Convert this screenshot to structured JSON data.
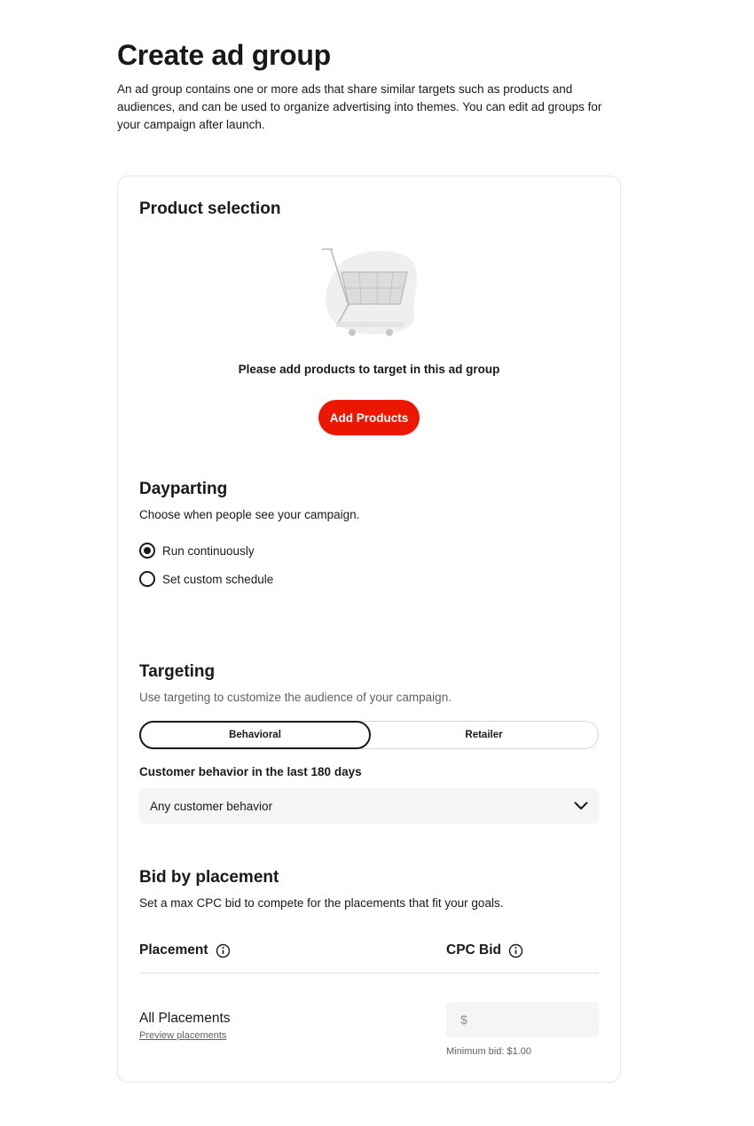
{
  "page": {
    "title": "Create ad group",
    "description": "An ad group contains one or more ads that share similar targets such as products and audiences, and can be used to organize advertising into themes. You can edit ad groups for your campaign after launch."
  },
  "product_selection": {
    "title": "Product selection",
    "empty_message": "Please add products to target in this ad group",
    "add_button_label": "Add Products",
    "illustration_icon": "shopping-cart-icon"
  },
  "dayparting": {
    "title": "Dayparting",
    "subtitle": "Choose when people see your campaign.",
    "options": [
      {
        "label": "Run continuously",
        "selected": true
      },
      {
        "label": "Set custom schedule",
        "selected": false
      }
    ]
  },
  "targeting": {
    "title": "Targeting",
    "subtitle": "Use targeting to customize the audience of your campaign.",
    "tabs": [
      {
        "label": "Behavioral",
        "active": true
      },
      {
        "label": "Retailer",
        "active": false
      }
    ],
    "field_label": "Customer behavior in the last 180 days",
    "select_value": "Any customer behavior"
  },
  "bid": {
    "title": "Bid by placement",
    "subtitle": "Set a max CPC bid to compete for the placements that fit your goals.",
    "col_placement": "Placement",
    "col_cpc": "CPC Bid",
    "row": {
      "name": "All Placements",
      "preview_link": "Preview placements",
      "currency_symbol": "$",
      "min_bid": "Minimum bid: $1.00"
    }
  },
  "colors": {
    "accent": "#eb1700",
    "text": "#191919",
    "muted": "#606060",
    "field_bg": "#f5f5f5"
  }
}
